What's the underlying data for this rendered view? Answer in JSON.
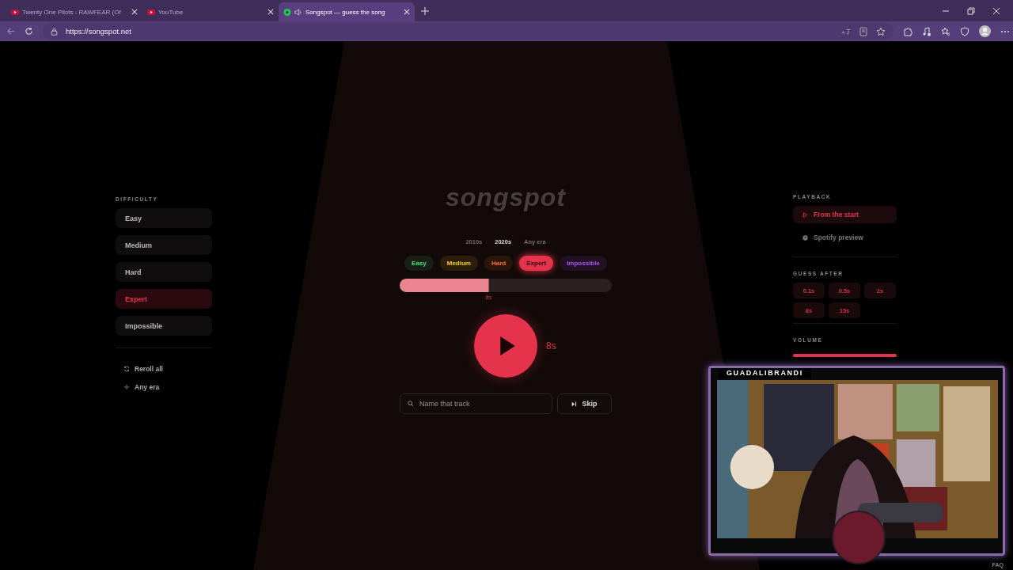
{
  "browser": {
    "tabs": [
      {
        "title": "Twenty One Pilots - RAWFEAR (Of",
        "kind": "video",
        "selected": false
      },
      {
        "title": "YouTube",
        "kind": "video",
        "selected": false
      },
      {
        "title": "Songspot — guess the song",
        "kind": "audio",
        "selected": true
      }
    ],
    "url": "https://songspot.net"
  },
  "logo": "songspot",
  "difficulty_panel": {
    "heading": "DIFFICULTY",
    "items": [
      {
        "label": "Easy",
        "selected": false
      },
      {
        "label": "Medium",
        "selected": false
      },
      {
        "label": "Hard",
        "selected": false
      },
      {
        "label": "Expert",
        "selected": true
      },
      {
        "label": "Impossible",
        "selected": false
      }
    ],
    "actions": [
      {
        "label": "Reroll all",
        "kind": "reroll"
      },
      {
        "label": "Any era",
        "kind": "era"
      }
    ]
  },
  "eras": [
    {
      "label": "2010s",
      "selected": false
    },
    {
      "label": "2020s",
      "selected": true
    },
    {
      "label": "Any era",
      "selected": false
    }
  ],
  "difficulty_pills": [
    {
      "label": "Easy",
      "color": "#4ade80",
      "selected": false
    },
    {
      "label": "Medium",
      "color": "#facc15",
      "selected": false
    },
    {
      "label": "Hard",
      "color": "#f97316",
      "selected": false
    },
    {
      "label": "Expert",
      "color": "#e5334b",
      "selected": true
    },
    {
      "label": "Impossible",
      "color": "#a855f7",
      "selected": false
    }
  ],
  "timeline": {
    "level": 0.42,
    "marker": "8s"
  },
  "play": {
    "duration": "8s"
  },
  "guess": {
    "placeholder": "Name that track",
    "skip": "Skip"
  },
  "playback_panel": {
    "heading": "PLAYBACK",
    "options": [
      {
        "label": "From the start",
        "kind": "start",
        "selected": true
      },
      {
        "label": "Spotify preview",
        "kind": "spotify",
        "selected": false
      }
    ],
    "guess_after_heading": "GUESS AFTER",
    "guess_after": [
      "0.1s",
      "0.5s",
      "2s",
      "8s",
      "15s"
    ],
    "volume_heading": "VOLUME",
    "volume": {
      "level": 1
    }
  },
  "webcam": {
    "name": "GUADALIBRANDI"
  },
  "footer_link": "FAQ"
}
